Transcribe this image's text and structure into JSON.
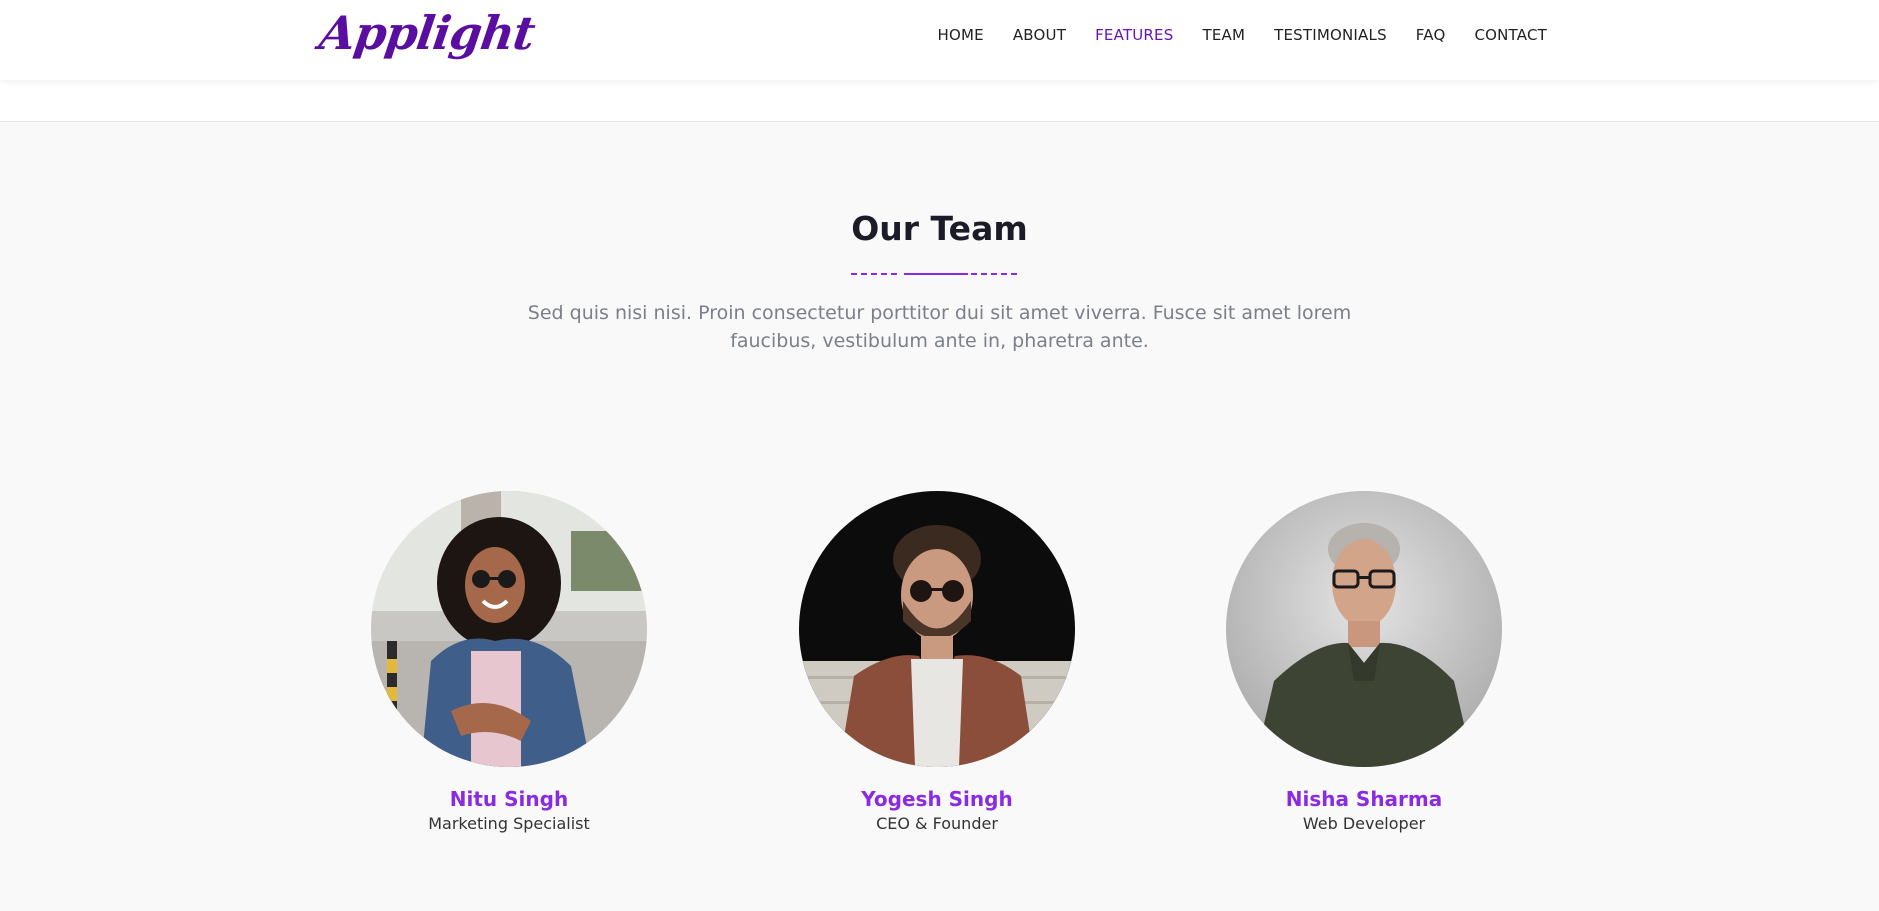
{
  "header": {
    "logo": "Applight",
    "nav": [
      "HOME",
      "ABOUT",
      "FEATURES",
      "TEAM",
      "TESTIMONIALS",
      "FAQ",
      "CONTACT"
    ],
    "active": "FEATURES"
  },
  "team": {
    "title": "Our Team",
    "subtitle": "Sed quis nisi nisi. Proin consectetur porttitor dui sit amet viverra. Fusce sit amet lorem faucibus, vestibulum ante in, pharetra ante.",
    "members": [
      {
        "name": "Nitu Singh",
        "role": "Marketing Specialist"
      },
      {
        "name": "Yogesh Singh",
        "role": "CEO & Founder"
      },
      {
        "name": "Nisha Sharma",
        "role": "Web Developer"
      }
    ]
  },
  "colors": {
    "accent": "#8a2be2",
    "logo": "#5a0ea0",
    "nav_active": "#6a14b8",
    "background": "#f9f9f9"
  }
}
